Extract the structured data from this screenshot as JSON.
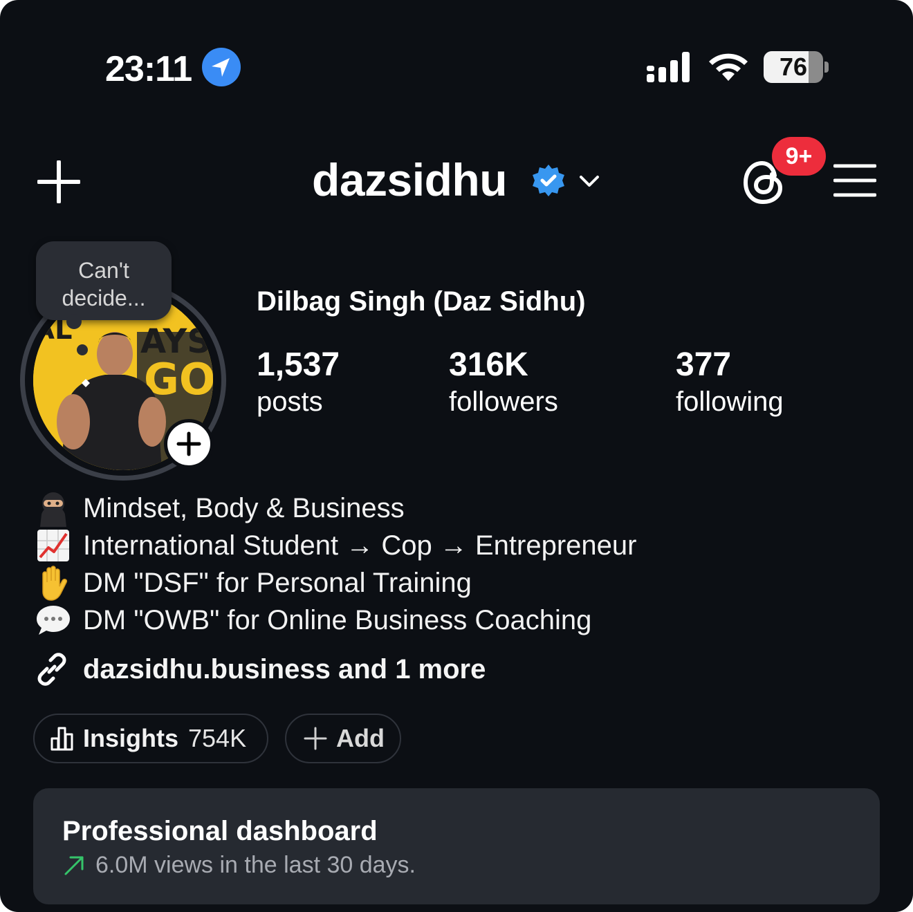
{
  "status_bar": {
    "time": "23:11",
    "battery_percent": "76",
    "battery_level": 0.76,
    "icons": [
      "location-arrow-icon",
      "cellular-signal-icon",
      "wifi-icon",
      "battery-icon"
    ]
  },
  "header": {
    "username": "dazsidhu",
    "verified": true,
    "notification_badge": "9+",
    "icons": [
      "plus-icon",
      "verified-icon",
      "chevron-down-icon",
      "threads-icon",
      "menu-icon"
    ]
  },
  "profile": {
    "note_text": "Can't decide...",
    "full_name": "Dilbag Singh (Daz Sidhu)",
    "stats": {
      "posts": {
        "value": "1,537",
        "label": "posts"
      },
      "followers": {
        "value": "316K",
        "label": "followers"
      },
      "following": {
        "value": "377",
        "label": "following"
      }
    }
  },
  "bio": {
    "lines": [
      {
        "emoji": "ninja-emoji",
        "text": "Mindset, Body & Business"
      },
      {
        "emoji": "chart-increasing-emoji",
        "text": "International Student → Cop → Entrepreneur"
      },
      {
        "emoji": "raised-hand-emoji",
        "text": "DM \"DSF\" for Personal Training"
      },
      {
        "emoji": "speech-bubble-emoji",
        "text": "DM \"OWB\" for Online Business Coaching"
      }
    ],
    "link_text": "dazsidhu.business and 1 more"
  },
  "pills": {
    "insights_label": "Insights",
    "insights_value": "754K",
    "add_label": "Add"
  },
  "dashboard": {
    "title": "Professional dashboard",
    "subtitle": "6.0M views in the last 30 days."
  },
  "colors": {
    "background": "#0c0f14",
    "badge": "#ed2d3c",
    "verified": "#3897f0",
    "trend_up": "#35c46a",
    "card": "#262a31"
  }
}
